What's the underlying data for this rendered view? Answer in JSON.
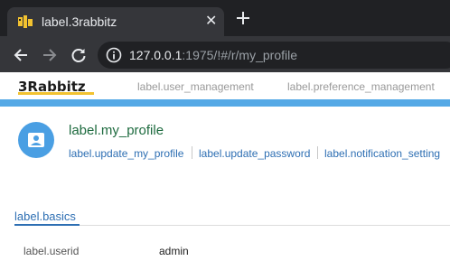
{
  "browser": {
    "tab_title": "label.3rabbitz",
    "tab_close": "✕",
    "url_host": "127.0.0.1",
    "url_rest": ":1975/!#/r/my_profile"
  },
  "app": {
    "logo_text": "3Rabbitz",
    "nav": [
      "label.user_management",
      "label.preference_management"
    ]
  },
  "profile": {
    "title": "label.my_profile",
    "links": [
      "label.update_my_profile",
      "label.update_password",
      "label.notification_setting"
    ]
  },
  "basics": {
    "tab_label": "label.basics",
    "fields": [
      {
        "label": "label.userid",
        "value": "admin"
      }
    ]
  },
  "colors": {
    "accent": "#55a9e6",
    "link": "#2e6fb3",
    "title": "#1e6b3f",
    "logo_dark": "#1a1a1a",
    "logo_yellow": "#f2c230"
  }
}
